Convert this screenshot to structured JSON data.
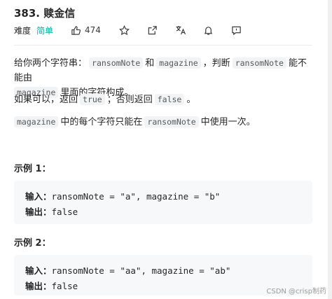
{
  "problem": {
    "title": "383. 赎金信",
    "difficulty_label": "难度",
    "difficulty": "简单",
    "likes": "474",
    "accent_color": "#00af9b"
  },
  "toolbar": {
    "icons": [
      "thumbs-up-icon",
      "star-icon",
      "share-icon",
      "translate-icon",
      "bell-icon",
      "comment-icon"
    ]
  },
  "description": {
    "p1_a": "给你两个字符串：",
    "p1_code1": "ransomNote",
    "p1_b": "和",
    "p1_code2": "magazine",
    "p1_c": "，判断",
    "p1_code3": "ransomNote",
    "p1_d": "能不能由",
    "p1_code4": "magazine",
    "p1_e": "里面的字符构成。",
    "p2_a": "如果可以，返回",
    "p2_code1": "true",
    "p2_b": "；否则返回",
    "p2_code2": "false",
    "p2_c": "。",
    "p3_code1": "magazine",
    "p3_a": "中的每个字符只能在",
    "p3_code2": "ransomNote",
    "p3_b": "中使用一次。"
  },
  "examples": [
    {
      "title": "示例 1：",
      "input_label": "输入：",
      "input": "ransomNote = \"a\", magazine = \"b\"",
      "output_label": "输出：",
      "output": "false"
    },
    {
      "title": "示例 2：",
      "input_label": "输入：",
      "input": "ransomNote = \"aa\", magazine = \"ab\"",
      "output_label": "输出：",
      "output": "false"
    }
  ],
  "watermark": "CSDN @crisp制药"
}
